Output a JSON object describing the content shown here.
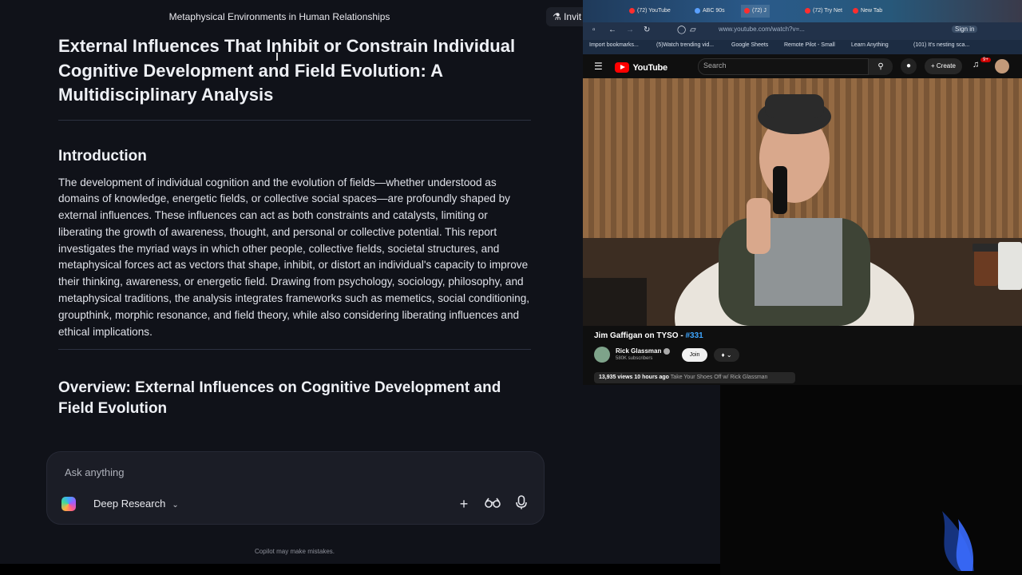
{
  "copilot": {
    "window_title": "Metaphysical Environments in Human Relationships",
    "invite_label": "Invit",
    "report_title": "External Influences That Inhibit or Constrain Individual Cognitive Development and Field Evolution: A Multidisciplinary Analysis",
    "sections": [
      {
        "heading": "Introduction",
        "body": "The development of individual cognition and the evolution of fields—whether understood as domains of knowledge, energetic fields, or collective social spaces—are profoundly shaped by external influences. These influences can act as both constraints and catalysts, limiting or liberating the growth of awareness, thought, and personal or collective potential. This report investigates the myriad ways in which other people, collective fields, societal structures, and metaphysical forces act as vectors that shape, inhibit, or distort an individual's capacity to improve their thinking, awareness, or energetic field. Drawing from psychology, sociology, philosophy, and metaphysical traditions, the analysis integrates frameworks such as memetics, social conditioning, groupthink, morphic resonance, and field theory, while also considering liberating influences and ethical implications."
      },
      {
        "heading": "Overview: External Influences on Cognitive Development and Field Evolution"
      }
    ],
    "composer": {
      "placeholder": "Ask anything",
      "mode_label": "Deep Research",
      "mode_icon": "chevron-down-icon"
    },
    "footnote": "Copilot may make mistakes."
  },
  "browser": {
    "tabs": [
      {
        "label": "(72) YouTube"
      },
      {
        "label": "ABC 90s"
      },
      {
        "label": "(72) J"
      },
      {
        "label": "(72) Try Net"
      },
      {
        "label": "New Tab"
      }
    ],
    "url": "www.youtube.com/watch?v=...",
    "bookmarks": [
      "Import bookmarks...",
      "(5)Watch trending vid...",
      "Google Sheets",
      "Remote Pilot - Small",
      "Learn Anything",
      "(101) It's nesting sca..."
    ],
    "sign_in_label": "Sign in"
  },
  "youtube": {
    "logo_text": "YouTube",
    "search_placeholder": "Search",
    "create_label": "Create",
    "notification_count": "9+",
    "video_title": "Jim Gaffigan on TYSO - ",
    "video_episode": "#331",
    "channel_name": "Rick Glassman",
    "subscribers": "580K subscribers",
    "join_label": "Join",
    "views": "13,935 views",
    "uploaded": "10 hours ago",
    "description_tag": "Take Your Shoes Off w/ Rick Glassman"
  }
}
